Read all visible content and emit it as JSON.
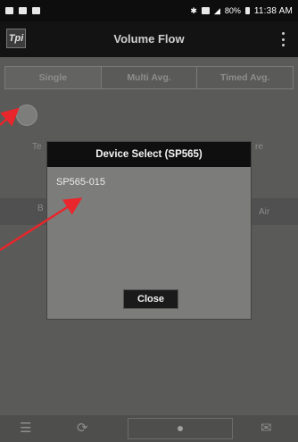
{
  "status_bar": {
    "battery": "80%",
    "time": "11:38 AM"
  },
  "app_bar": {
    "logo_text": "Tpi",
    "title": "Volume Flow"
  },
  "tabs": [
    {
      "label": "Single",
      "active": true
    },
    {
      "label": "Multi Avg.",
      "active": false
    },
    {
      "label": "Timed Avg.",
      "active": false
    }
  ],
  "background": {
    "text_left_fragment": "Te",
    "text_right_fragment": "re",
    "band_left_fragment": "B",
    "band_right_fragment": "Air"
  },
  "dialog": {
    "title": "Device Select (SP565)",
    "devices": [
      "SP565-015"
    ],
    "close_label": "Close"
  },
  "annotation_color": "#e8262b"
}
